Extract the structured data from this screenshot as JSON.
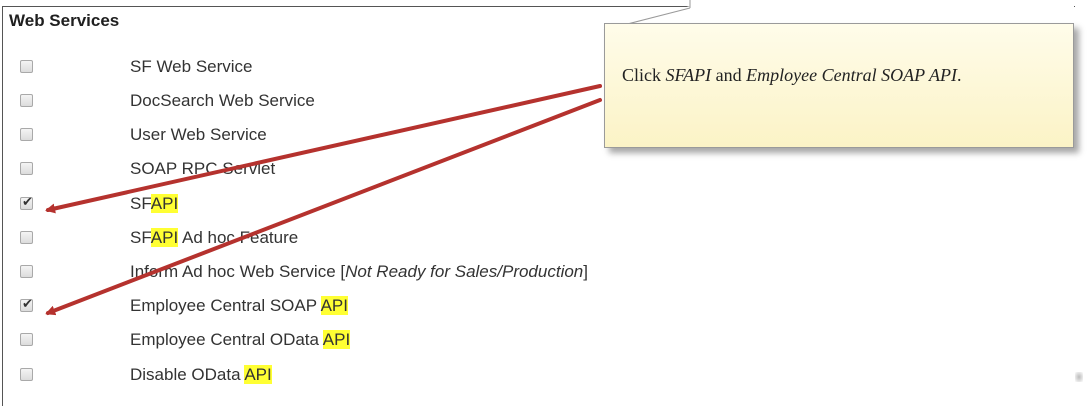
{
  "section": {
    "title": "Web Services"
  },
  "services": [
    {
      "name": "SF Web Service",
      "checked": false
    },
    {
      "name": "DocSearch Web Service",
      "checked": false
    },
    {
      "name": "User Web Service",
      "checked": false
    },
    {
      "name": "SOAP RPC Servlet",
      "checked": false
    },
    {
      "name_prefix": "SF",
      "name_highlight": "API",
      "name_suffix": "",
      "checked": true
    },
    {
      "name_prefix": "SF",
      "name_highlight": "API",
      "name_suffix": " Ad hoc Feature",
      "checked": false
    },
    {
      "name_prefix": "Inform Ad hoc Web Service [",
      "name_italic": "Not Ready for Sales/Production",
      "name_suffix": "]",
      "checked": false
    },
    {
      "name_prefix": "Employee Central SOAP ",
      "name_highlight": "API",
      "checked": true
    },
    {
      "name_prefix": "Employee Central OData ",
      "name_highlight": "API",
      "checked": false
    },
    {
      "name_prefix": "Disable OData ",
      "name_highlight": "API",
      "checked": false
    }
  ],
  "callout": {
    "prefix": "Click ",
    "item1": "SFAPI",
    "middle": " and ",
    "item2": "Employee Central SOAP API",
    "suffix": "."
  },
  "colors": {
    "highlight": "#ffff33",
    "arrow": "#b5322e",
    "callout_bg": "#fdf6d3"
  },
  "icons": {
    "checkbox_checked": "checkmark",
    "annotation_arrow": "red-arrow"
  }
}
